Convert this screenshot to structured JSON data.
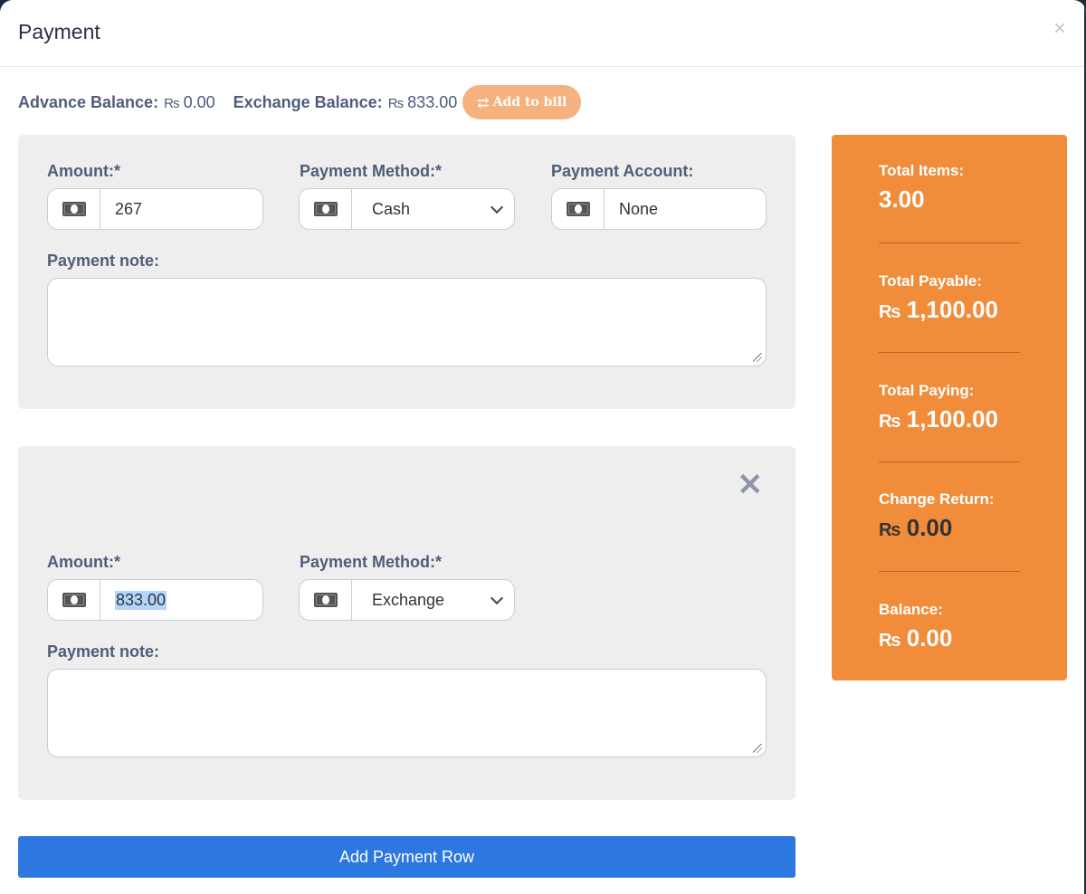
{
  "modal": {
    "title": "Payment",
    "close": "×"
  },
  "balances": {
    "advance_label": "Advance Balance:",
    "advance_value": "0.00",
    "exchange_label": "Exchange Balance:",
    "exchange_value": "833.00",
    "currency_symbol": "₨",
    "add_to_bill_icon": "⇄",
    "add_to_bill_label": "Add to bill"
  },
  "rows": [
    {
      "amount_label": "Amount:*",
      "amount_value": "267",
      "method_label": "Payment Method:*",
      "method_value": "Cash",
      "account_label": "Payment Account:",
      "account_value": "None",
      "note_label": "Payment note:",
      "note_value": ""
    },
    {
      "remove": "✕",
      "amount_label": "Amount:*",
      "amount_value": "833.00",
      "method_label": "Payment Method:*",
      "method_value": "Exchange",
      "note_label": "Payment note:",
      "note_value": ""
    }
  ],
  "add_row_label": "Add Payment Row",
  "summary": {
    "currency_symbol": "₨",
    "total_items_label": "Total Items:",
    "total_items_value": "3.00",
    "total_payable_label": "Total Payable:",
    "total_payable_value": "1,100.00",
    "total_paying_label": "Total Paying:",
    "total_paying_value": "1,100.00",
    "change_return_label": "Change Return:",
    "change_return_value": "0.00",
    "balance_label": "Balance:",
    "balance_value": "0.00"
  },
  "colors": {
    "summary_bg": "#f08c3a",
    "add_row_bg": "#2d77e0",
    "add_bill_bg": "#f5b27e"
  }
}
